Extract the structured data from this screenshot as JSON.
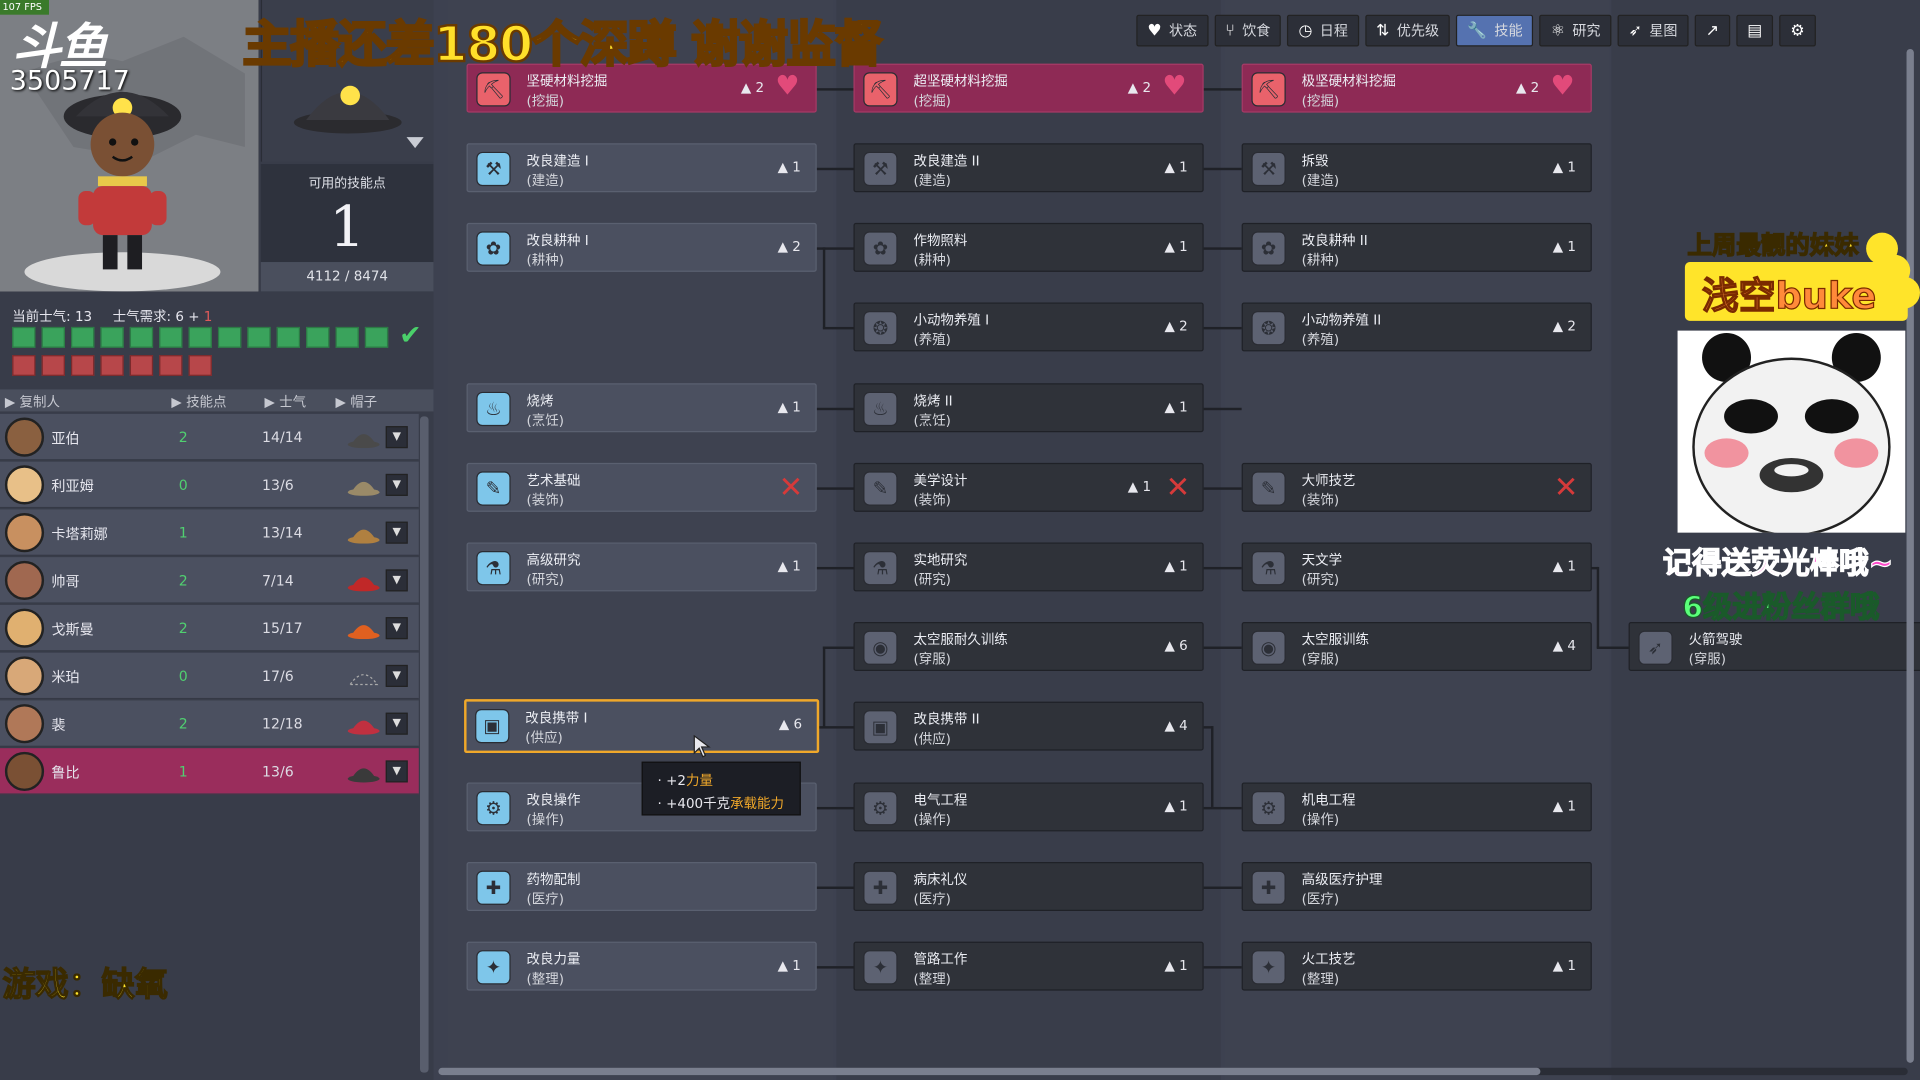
{
  "overlay": {
    "fps": "107 FPS",
    "logo": "斗鱼",
    "room_id": "3505717",
    "banner": "主播还差180个深蹲 谢谢监督",
    "prettiest_label": "上周最靓的妹妹",
    "prettiest_name": "浅空buke",
    "reminder_line1": "记得送荧光棒哦~",
    "reminder_line2": "6级进粉丝群哦",
    "game_label": "游戏：缺氧"
  },
  "top_toolbar": [
    {
      "label": "状态",
      "icon": "heart-icon",
      "active": false
    },
    {
      "label": "饮食",
      "icon": "cutlery-icon",
      "active": false
    },
    {
      "label": "日程",
      "icon": "clock-icon",
      "active": false
    },
    {
      "label": "优先级",
      "icon": "priority-arrows-icon",
      "active": false
    },
    {
      "label": "技能",
      "icon": "wrench-icon",
      "active": true
    },
    {
      "label": "研究",
      "icon": "research-icon",
      "active": false
    },
    {
      "label": "星图",
      "icon": "rocket-icon",
      "active": false
    },
    {
      "label": "",
      "icon": "chart-icon",
      "active": false
    },
    {
      "label": "",
      "icon": "book-icon",
      "active": false
    },
    {
      "label": "",
      "icon": "gear-icon",
      "active": false
    }
  ],
  "skill_points": {
    "label": "可用的技能点",
    "value": "1",
    "xp": "4112 / 8474"
  },
  "morale": {
    "current_label": "当前士气: 13",
    "required_label": "士气需求: 6 + ",
    "required_bonus": "1",
    "green_count": 13,
    "red_count": 7
  },
  "roster_headers": {
    "name": "复制人",
    "points": "技能点",
    "morale": "士气",
    "hat": "帽子"
  },
  "duplicants": [
    {
      "name": "亚伯",
      "points": "2",
      "morale": "14/14",
      "selected": false,
      "face": "#8a6040",
      "hat": "#4a4a4a"
    },
    {
      "name": "利亚姆",
      "points": "0",
      "morale": "13/6",
      "selected": false,
      "face": "#e8c088",
      "hat": "#9a8a68"
    },
    {
      "name": "卡塔莉娜",
      "points": "1",
      "morale": "13/14",
      "selected": false,
      "face": "#c89060",
      "hat": "#b08040"
    },
    {
      "name": "帅哥",
      "points": "2",
      "morale": "7/14",
      "selected": false,
      "face": "#a06850",
      "hat": "#c02828"
    },
    {
      "name": "戈斯曼",
      "points": "2",
      "morale": "15/17",
      "selected": false,
      "face": "#e0b070",
      "hat": "#e06020"
    },
    {
      "name": "米珀",
      "points": "0",
      "morale": "17/6",
      "selected": false,
      "face": "#d8a878",
      "hat": ""
    },
    {
      "name": "裴",
      "points": "2",
      "morale": "12/18",
      "selected": false,
      "face": "#b07858",
      "hat": "#c03040"
    },
    {
      "name": "鲁比",
      "points": "1",
      "morale": "13/6",
      "selected": true,
      "face": "#7a5034",
      "hat": "#3a3a3a"
    }
  ],
  "skills": {
    "c1": [
      {
        "name": "坚硬材料挖掘",
        "cat": "(挖掘)",
        "cost": "2",
        "state": "mastered",
        "icon": "pickaxe-icon"
      },
      {
        "name": "改良建造 I",
        "cat": "(建造)",
        "cost": "1",
        "state": "available",
        "icon": "hammer-icon"
      },
      {
        "name": "改良耕种 I",
        "cat": "(耕种)",
        "cost": "2",
        "state": "available",
        "icon": "plant-icon"
      },
      {
        "name": "烧烤",
        "cat": "(烹饪)",
        "cost": "1",
        "state": "available",
        "icon": "cook-icon"
      },
      {
        "name": "艺术基础",
        "cat": "(装饰)",
        "cost": "",
        "state": "blocked",
        "icon": "brush-icon"
      },
      {
        "name": "高级研究",
        "cat": "(研究)",
        "cost": "1",
        "state": "available",
        "icon": "flask-icon"
      },
      {
        "name": "改良携带 I",
        "cat": "(供应)",
        "cost": "6",
        "state": "focused",
        "icon": "box-icon"
      },
      {
        "name": "改良操作",
        "cat": "(操作)",
        "cost": "",
        "state": "available",
        "icon": "gear-icon"
      },
      {
        "name": "药物配制",
        "cat": "(医疗)",
        "cost": "",
        "state": "available",
        "icon": "pill-icon"
      },
      {
        "name": "改良力量",
        "cat": "(整理)",
        "cost": "1",
        "state": "available",
        "icon": "broom-icon"
      }
    ],
    "c2": [
      {
        "name": "超坚硬材料挖掘",
        "cat": "(挖掘)",
        "cost": "2",
        "state": "mastered",
        "icon": "pickaxe-icon"
      },
      {
        "name": "改良建造 II",
        "cat": "(建造)",
        "cost": "1",
        "state": "locked",
        "icon": "hammer-icon"
      },
      {
        "name": "作物照料",
        "cat": "(耕种)",
        "cost": "1",
        "state": "locked",
        "icon": "plant-icon"
      },
      {
        "name": "小动物养殖 I",
        "cat": "(养殖)",
        "cost": "2",
        "state": "locked",
        "icon": "critter-icon"
      },
      {
        "name": "烧烤 II",
        "cat": "(烹饪)",
        "cost": "1",
        "state": "locked",
        "icon": "cook-icon"
      },
      {
        "name": "美学设计",
        "cat": "(装饰)",
        "cost": "1",
        "state": "blocked",
        "icon": "brush-icon"
      },
      {
        "name": "实地研究",
        "cat": "(研究)",
        "cost": "1",
        "state": "locked",
        "icon": "flask-icon"
      },
      {
        "name": "太空服耐久训练",
        "cat": "(穿服)",
        "cost": "6",
        "state": "locked",
        "icon": "suit-icon"
      },
      {
        "name": "改良携带 II",
        "cat": "(供应)",
        "cost": "4",
        "state": "locked",
        "icon": "box-icon"
      },
      {
        "name": "电气工程",
        "cat": "(操作)",
        "cost": "1",
        "state": "locked",
        "icon": "gear-icon"
      },
      {
        "name": "病床礼仪",
        "cat": "(医疗)",
        "cost": "",
        "state": "locked",
        "icon": "pill-icon"
      },
      {
        "name": "管路工作",
        "cat": "(整理)",
        "cost": "1",
        "state": "locked",
        "icon": "broom-icon"
      }
    ],
    "c3": [
      {
        "name": "极坚硬材料挖掘",
        "cat": "(挖掘)",
        "cost": "2",
        "state": "mastered",
        "icon": "pickaxe-icon"
      },
      {
        "name": "拆毁",
        "cat": "(建造)",
        "cost": "1",
        "state": "locked",
        "icon": "hammer-icon"
      },
      {
        "name": "改良耕种 II",
        "cat": "(耕种)",
        "cost": "1",
        "state": "locked",
        "icon": "plant-icon"
      },
      {
        "name": "小动物养殖 II",
        "cat": "(养殖)",
        "cost": "2",
        "state": "locked",
        "icon": "critter-icon"
      },
      {
        "name": "大师技艺",
        "cat": "(装饰)",
        "cost": "",
        "state": "blocked",
        "icon": "brush-icon"
      },
      {
        "name": "天文学",
        "cat": "(研究)",
        "cost": "1",
        "state": "locked",
        "icon": "flask-icon"
      },
      {
        "name": "太空服训练",
        "cat": "(穿服)",
        "cost": "4",
        "state": "locked",
        "icon": "suit-icon"
      },
      {
        "name": "机电工程",
        "cat": "(操作)",
        "cost": "1",
        "state": "locked",
        "icon": "gear-icon"
      },
      {
        "name": "高级医疗护理",
        "cat": "(医疗)",
        "cost": "",
        "state": "locked",
        "icon": "pill-icon"
      },
      {
        "name": "火工技艺",
        "cat": "(整理)",
        "cost": "1",
        "state": "locked",
        "icon": "broom-icon"
      }
    ],
    "c4": [
      {
        "name": "火箭驾驶",
        "cat": "(穿服)",
        "cost": "",
        "state": "locked",
        "icon": "rocket-icon"
      }
    ]
  },
  "tooltip": {
    "line1_prefix": "+2",
    "line1_attr": "力量",
    "line2_prefix": "+400千克",
    "line2_attr": "承载能力"
  }
}
